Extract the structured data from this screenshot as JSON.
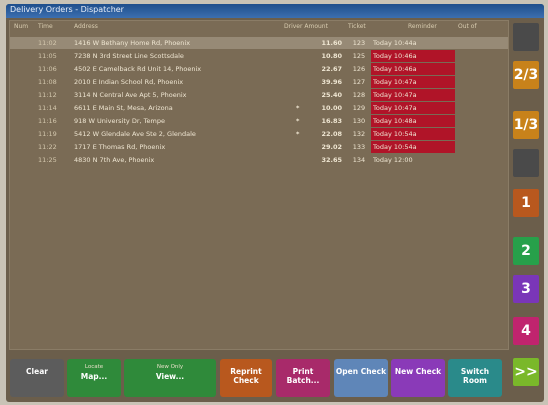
{
  "window": {
    "title": "Delivery Orders - Dispatcher"
  },
  "columns": {
    "num": "Num",
    "time": "Time",
    "address": "Address",
    "driver_amount": "Driver Amount",
    "ticket": "Ticket",
    "reminder": "Reminder",
    "out_of": "Out of"
  },
  "orders": [
    {
      "time": "11:02",
      "address": "1416 W Bethany Home Rd, Phoenix",
      "marker": "",
      "amount": "11.60",
      "ticket": "123",
      "reminder": "Today 10:44a",
      "red": false
    },
    {
      "time": "11:05",
      "address": "7238 N 3rd Street Line Scottsdale",
      "marker": "",
      "amount": "10.80",
      "ticket": "125",
      "reminder": "Today 10:46a",
      "red": true
    },
    {
      "time": "11:06",
      "address": "4502 E Camelback Rd Unit 14, Phoenix",
      "marker": "",
      "amount": "22.67",
      "ticket": "126",
      "reminder": "Today 10:46a",
      "red": true
    },
    {
      "time": "11:08",
      "address": "2010 E Indian School Rd, Phoenix",
      "marker": "",
      "amount": "39.96",
      "ticket": "127",
      "reminder": "Today 10:47a",
      "red": true
    },
    {
      "time": "11:12",
      "address": "3114 N Central Ave Apt 5, Phoenix",
      "marker": "",
      "amount": "25.40",
      "ticket": "128",
      "reminder": "Today 10:47a",
      "red": true
    },
    {
      "time": "11:14",
      "address": "6611 E Main St, Mesa, Arizona",
      "marker": "*",
      "amount": "10.00",
      "ticket": "129",
      "reminder": "Today 10:47a",
      "red": true
    },
    {
      "time": "11:16",
      "address": "918 W University Dr, Tempe",
      "marker": "*",
      "amount": "16.83",
      "ticket": "130",
      "reminder": "Today 10:48a",
      "red": true
    },
    {
      "time": "11:19",
      "address": "5412 W Glendale Ave Ste 2, Glendale",
      "marker": "*",
      "amount": "22.08",
      "ticket": "132",
      "reminder": "Today 10:54a",
      "red": true
    },
    {
      "time": "11:22",
      "address": "1717 E Thomas Rd, Phoenix",
      "marker": "",
      "amount": "29.02",
      "ticket": "133",
      "reminder": "Today 10:54a",
      "red": true
    },
    {
      "time": "11:25",
      "address": "4830 N 7th Ave, Phoenix",
      "marker": "",
      "amount": "32.65",
      "ticket": "134",
      "reminder": "Today 12:00",
      "red": false
    }
  ],
  "side_buttons": [
    {
      "label": "",
      "color": "#4a4a4a"
    },
    {
      "label": "2/3",
      "color": "#c8821a"
    },
    {
      "label": "1/3",
      "color": "#c8821a"
    },
    {
      "label": "",
      "color": "#4a4a4a"
    },
    {
      "label": "1",
      "color": "#b8581e"
    },
    {
      "label": "2",
      "color": "#27a04a"
    },
    {
      "label": "3",
      "color": "#7a36b8"
    },
    {
      "label": "4",
      "color": "#c0246e"
    },
    {
      "label": ">>",
      "color": "#7ab82a"
    }
  ],
  "bottom_buttons": [
    {
      "sub": "",
      "label": "Clear",
      "color": "#5c5c5c"
    },
    {
      "sub": "Locate",
      "label": "Map...",
      "color": "#2f8a3a"
    },
    {
      "sub": "New Only",
      "label": "View...",
      "color": "#2f8a3a"
    },
    {
      "sub": "",
      "label": "Reprint Check",
      "color": "#b8581e"
    },
    {
      "sub": "",
      "label": "Print Batch...",
      "color": "#a82a6a"
    },
    {
      "sub": "",
      "label": "Open Check",
      "color": "#5f86b8"
    },
    {
      "sub": "",
      "label": "New Check",
      "color": "#8a3ab8"
    },
    {
      "sub": "",
      "label": "Switch Room",
      "color": "#2a8a8a"
    }
  ]
}
